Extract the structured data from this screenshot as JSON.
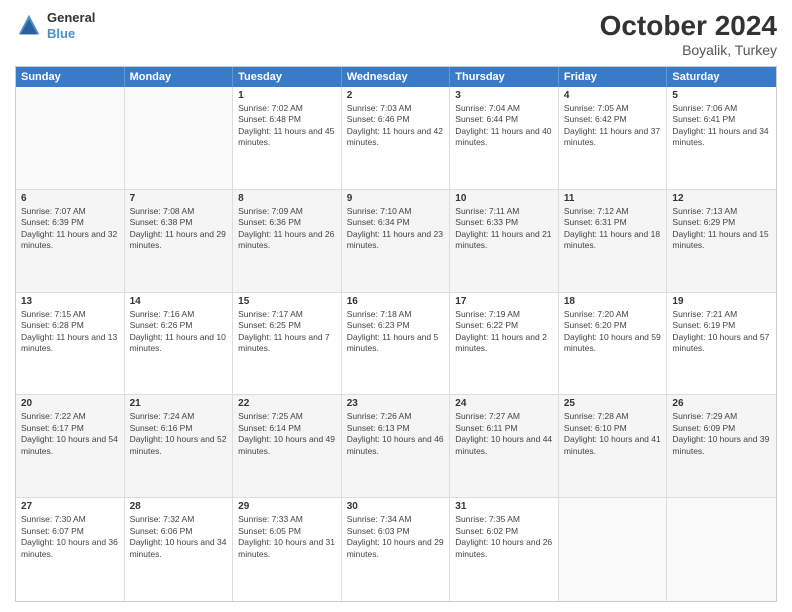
{
  "header": {
    "logo_line1": "General",
    "logo_line2": "Blue",
    "month": "October 2024",
    "location": "Boyalik, Turkey"
  },
  "weekdays": [
    "Sunday",
    "Monday",
    "Tuesday",
    "Wednesday",
    "Thursday",
    "Friday",
    "Saturday"
  ],
  "weeks": [
    [
      {
        "day": "",
        "detail": ""
      },
      {
        "day": "",
        "detail": ""
      },
      {
        "day": "1",
        "detail": "Sunrise: 7:02 AM\nSunset: 6:48 PM\nDaylight: 11 hours and 45 minutes."
      },
      {
        "day": "2",
        "detail": "Sunrise: 7:03 AM\nSunset: 6:46 PM\nDaylight: 11 hours and 42 minutes."
      },
      {
        "day": "3",
        "detail": "Sunrise: 7:04 AM\nSunset: 6:44 PM\nDaylight: 11 hours and 40 minutes."
      },
      {
        "day": "4",
        "detail": "Sunrise: 7:05 AM\nSunset: 6:42 PM\nDaylight: 11 hours and 37 minutes."
      },
      {
        "day": "5",
        "detail": "Sunrise: 7:06 AM\nSunset: 6:41 PM\nDaylight: 11 hours and 34 minutes."
      }
    ],
    [
      {
        "day": "6",
        "detail": "Sunrise: 7:07 AM\nSunset: 6:39 PM\nDaylight: 11 hours and 32 minutes."
      },
      {
        "day": "7",
        "detail": "Sunrise: 7:08 AM\nSunset: 6:38 PM\nDaylight: 11 hours and 29 minutes."
      },
      {
        "day": "8",
        "detail": "Sunrise: 7:09 AM\nSunset: 6:36 PM\nDaylight: 11 hours and 26 minutes."
      },
      {
        "day": "9",
        "detail": "Sunrise: 7:10 AM\nSunset: 6:34 PM\nDaylight: 11 hours and 23 minutes."
      },
      {
        "day": "10",
        "detail": "Sunrise: 7:11 AM\nSunset: 6:33 PM\nDaylight: 11 hours and 21 minutes."
      },
      {
        "day": "11",
        "detail": "Sunrise: 7:12 AM\nSunset: 6:31 PM\nDaylight: 11 hours and 18 minutes."
      },
      {
        "day": "12",
        "detail": "Sunrise: 7:13 AM\nSunset: 6:29 PM\nDaylight: 11 hours and 15 minutes."
      }
    ],
    [
      {
        "day": "13",
        "detail": "Sunrise: 7:15 AM\nSunset: 6:28 PM\nDaylight: 11 hours and 13 minutes."
      },
      {
        "day": "14",
        "detail": "Sunrise: 7:16 AM\nSunset: 6:26 PM\nDaylight: 11 hours and 10 minutes."
      },
      {
        "day": "15",
        "detail": "Sunrise: 7:17 AM\nSunset: 6:25 PM\nDaylight: 11 hours and 7 minutes."
      },
      {
        "day": "16",
        "detail": "Sunrise: 7:18 AM\nSunset: 6:23 PM\nDaylight: 11 hours and 5 minutes."
      },
      {
        "day": "17",
        "detail": "Sunrise: 7:19 AM\nSunset: 6:22 PM\nDaylight: 11 hours and 2 minutes."
      },
      {
        "day": "18",
        "detail": "Sunrise: 7:20 AM\nSunset: 6:20 PM\nDaylight: 10 hours and 59 minutes."
      },
      {
        "day": "19",
        "detail": "Sunrise: 7:21 AM\nSunset: 6:19 PM\nDaylight: 10 hours and 57 minutes."
      }
    ],
    [
      {
        "day": "20",
        "detail": "Sunrise: 7:22 AM\nSunset: 6:17 PM\nDaylight: 10 hours and 54 minutes."
      },
      {
        "day": "21",
        "detail": "Sunrise: 7:24 AM\nSunset: 6:16 PM\nDaylight: 10 hours and 52 minutes."
      },
      {
        "day": "22",
        "detail": "Sunrise: 7:25 AM\nSunset: 6:14 PM\nDaylight: 10 hours and 49 minutes."
      },
      {
        "day": "23",
        "detail": "Sunrise: 7:26 AM\nSunset: 6:13 PM\nDaylight: 10 hours and 46 minutes."
      },
      {
        "day": "24",
        "detail": "Sunrise: 7:27 AM\nSunset: 6:11 PM\nDaylight: 10 hours and 44 minutes."
      },
      {
        "day": "25",
        "detail": "Sunrise: 7:28 AM\nSunset: 6:10 PM\nDaylight: 10 hours and 41 minutes."
      },
      {
        "day": "26",
        "detail": "Sunrise: 7:29 AM\nSunset: 6:09 PM\nDaylight: 10 hours and 39 minutes."
      }
    ],
    [
      {
        "day": "27",
        "detail": "Sunrise: 7:30 AM\nSunset: 6:07 PM\nDaylight: 10 hours and 36 minutes."
      },
      {
        "day": "28",
        "detail": "Sunrise: 7:32 AM\nSunset: 6:06 PM\nDaylight: 10 hours and 34 minutes."
      },
      {
        "day": "29",
        "detail": "Sunrise: 7:33 AM\nSunset: 6:05 PM\nDaylight: 10 hours and 31 minutes."
      },
      {
        "day": "30",
        "detail": "Sunrise: 7:34 AM\nSunset: 6:03 PM\nDaylight: 10 hours and 29 minutes."
      },
      {
        "day": "31",
        "detail": "Sunrise: 7:35 AM\nSunset: 6:02 PM\nDaylight: 10 hours and 26 minutes."
      },
      {
        "day": "",
        "detail": ""
      },
      {
        "day": "",
        "detail": ""
      }
    ]
  ]
}
